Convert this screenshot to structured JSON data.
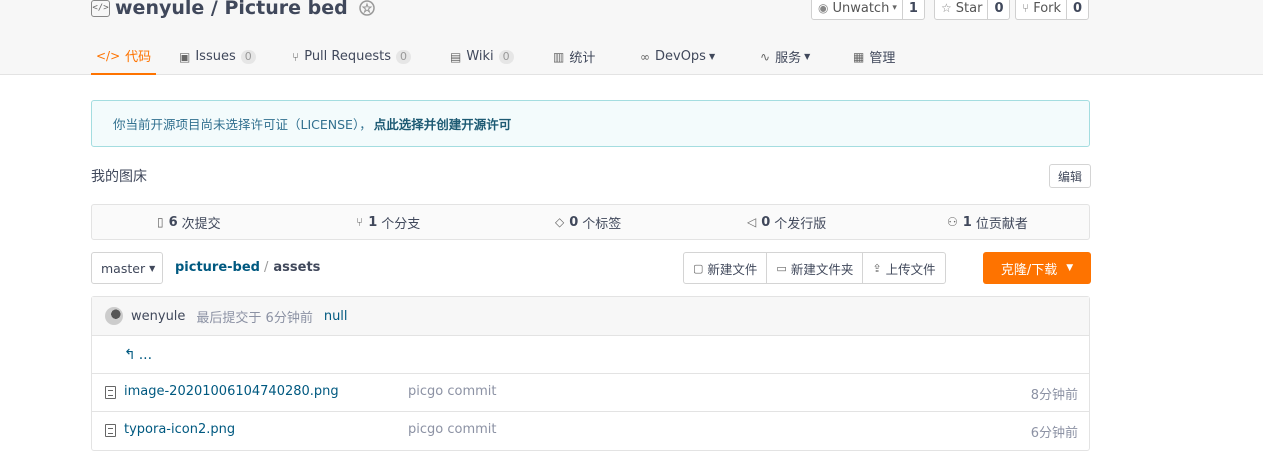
{
  "repo": {
    "title": "wenyule / Picture bed"
  },
  "social": [
    {
      "label": "Unwatch",
      "icon": "eye-icon",
      "count": "1"
    },
    {
      "label": "Star",
      "icon": "star-icon",
      "count": "0"
    },
    {
      "label": "Fork",
      "icon": "fork-icon",
      "count": "0"
    }
  ],
  "tabs": [
    {
      "label": "代码",
      "icon": "code-icon"
    },
    {
      "label": "Issues",
      "icon": "issues-icon",
      "count": "0"
    },
    {
      "label": "Pull Requests",
      "icon": "pull-request-icon",
      "count": "0"
    },
    {
      "label": "Wiki",
      "icon": "wiki-icon",
      "count": "0"
    },
    {
      "label": "统计",
      "icon": "stats-icon"
    },
    {
      "label": "DevOps",
      "icon": "devops-icon"
    },
    {
      "label": "服务",
      "icon": "service-icon"
    },
    {
      "label": "管理",
      "icon": "manage-icon"
    }
  ],
  "notice": {
    "text": "你当前开源项目尚未选择许可证（LICENSE），",
    "link": "点此选择并创建开源许可"
  },
  "description": "我的图床",
  "edit_label": "编辑",
  "stats": [
    {
      "count": "6",
      "label": "次提交",
      "icon": "commit-icon"
    },
    {
      "count": "1",
      "label": "个分支",
      "icon": "branch-icon"
    },
    {
      "count": "0",
      "label": "个标签",
      "icon": "tag-icon"
    },
    {
      "count": "0",
      "label": "个发行版",
      "icon": "release-icon"
    },
    {
      "count": "1",
      "label": "位贡献者",
      "icon": "contributors-icon"
    }
  ],
  "branch": "master",
  "breadcrumb": {
    "repo": "picture-bed",
    "sep": "/",
    "current": "assets"
  },
  "actions": [
    {
      "label": "新建文件",
      "icon": "new-file-icon"
    },
    {
      "label": "新建文件夹",
      "icon": "new-folder-icon"
    },
    {
      "label": "上传文件",
      "icon": "upload-icon"
    }
  ],
  "clone_label": "克隆/下载",
  "last_commit": {
    "author": "wenyule",
    "meta": "最后提交于 6分钟前",
    "message": "null"
  },
  "up_dir": "...",
  "files": [
    {
      "name": "image-20201006104740280.png",
      "message": "picgo commit",
      "time": "8分钟前"
    },
    {
      "name": "typora-icon2.png",
      "message": "picgo commit",
      "time": "6分钟前"
    }
  ],
  "colors": {
    "accent": "#fe7300",
    "link": "#005980",
    "notice_bg": "#f3fbfc",
    "notice_border": "#a4dde0"
  }
}
